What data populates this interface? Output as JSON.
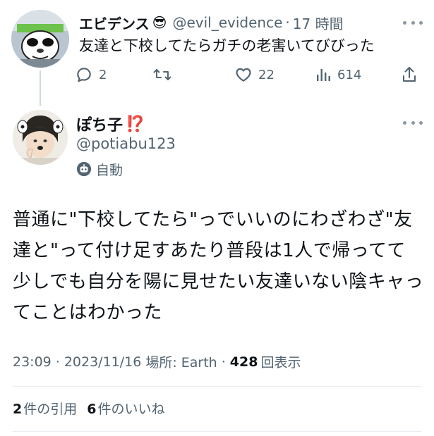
{
  "parent_tweet": {
    "author_name": "エビデンス",
    "author_emoji": "😎",
    "handle": "@evil_evidence",
    "separator": "·",
    "time": "17 時間",
    "text": "友達と下校してたらガチの老害いてびびった",
    "actions": {
      "replies": "2",
      "retweets": "",
      "likes": "22",
      "views": "614"
    },
    "icons": [
      "reply-icon",
      "retweet-icon",
      "like-icon",
      "views-icon",
      "share-icon",
      "more-icon"
    ]
  },
  "main_tweet": {
    "author_name": "ぽち子",
    "author_badge": "⁉️",
    "handle": "@potiabu123",
    "automated_label": "自動",
    "text_lines": [
      "普通に\"下校してたら\"っでいいのにわざわざ\"友",
      "達と\"って付け足すあたり普段は1人で帰ってて",
      "少しでも自分を陽に見せたい友達いない陰キャっ",
      "てことはわかった"
    ],
    "meta": {
      "time": "23:09",
      "sep1": "·",
      "date": "2023/11/16",
      "location": "場所: Earth",
      "sep2": "·",
      "views_count": "428",
      "views_label": "回表示"
    },
    "stats": {
      "quotes_count": "2",
      "quotes_label": "件の引用",
      "likes_count": "6",
      "likes_label": "件のいいね"
    }
  },
  "colors": {
    "text_primary": "#0f1419",
    "text_secondary": "#536471",
    "divider": "#e6ecf0",
    "thread_line": "#cfd9de",
    "badge_red": "#e0245e"
  }
}
